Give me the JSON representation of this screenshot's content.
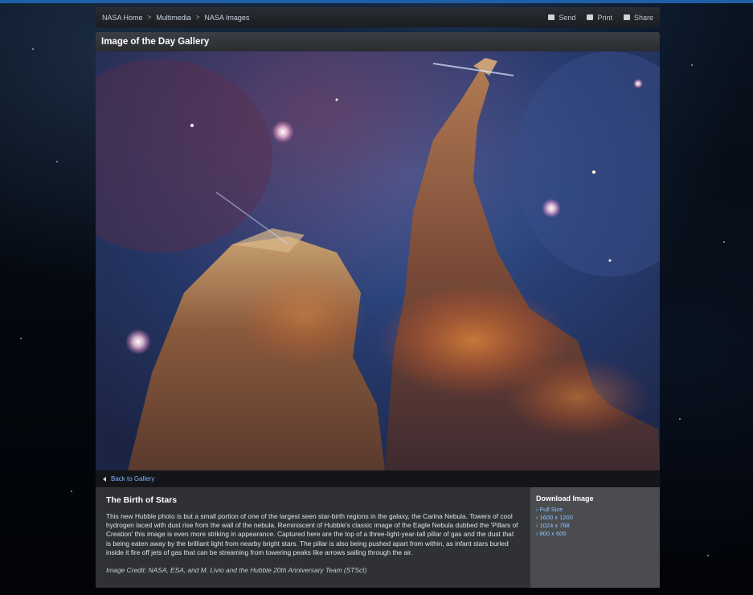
{
  "breadcrumb": {
    "items": [
      "NASA Home",
      "Multimedia",
      "NASA Images"
    ],
    "separator": ">"
  },
  "actions": {
    "send": "Send",
    "print": "Print",
    "share": "Share"
  },
  "gallery": {
    "title": "Image of the Day Gallery",
    "back_link": "Back to Gallery"
  },
  "article": {
    "title": "The Birth of Stars",
    "body": "This new Hubble photo is but a small portion of one of the largest seen star-birth regions in the galaxy, the Carina Nebula. Towers of cool hydrogen laced with dust rise from the wall of the nebula. Reminiscent of Hubble's classic image of the Eagle Nebula dubbed the 'Pillars of Creation' this image is even more striking in appearance. Captured here are the top of a three-light-year-tall pillar of gas and the dust that is being eaten away by the brilliant light from nearby bright stars. The pillar is also being pushed apart from within, as infant stars buried inside it fire off jets of gas that can be streaming from towering peaks like arrows sailing through the air.",
    "credit": "Image Credit: NASA, ESA, and M. Livio and the Hubble 20th Anniversary Team (STScI)"
  },
  "download": {
    "title": "Download Image",
    "links": [
      "› Full Size",
      "› 1600 x 1200",
      "› 1024 x 768",
      "› 800 x 600"
    ]
  },
  "colors": {
    "link": "#8ec5ff",
    "header_bg": "#2a2c31",
    "panel_bg": "#2f3135",
    "download_bg": "#4a4c50"
  }
}
